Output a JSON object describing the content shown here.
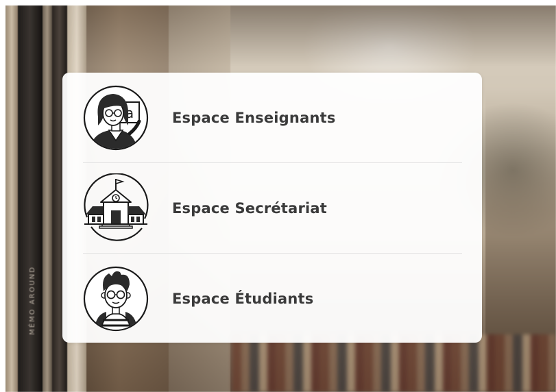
{
  "menu": {
    "items": [
      {
        "label": "Espace Enseignants",
        "icon": "teacher-icon"
      },
      {
        "label": "Espace Secrétariat",
        "icon": "school-building-icon"
      },
      {
        "label": "Espace Étudiants",
        "icon": "student-icon"
      }
    ],
    "teacher_board_letter": "a"
  },
  "background": {
    "spine_text": "MÉMO AROUND"
  },
  "colors": {
    "label_text": "#3a3a3a",
    "icon_stroke": "#1a1a1a",
    "panel_bg": "#ffffff",
    "divider": "#e2e2e2"
  }
}
